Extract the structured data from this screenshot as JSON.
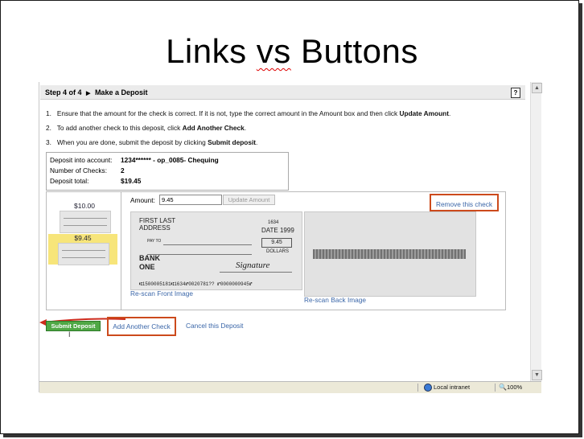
{
  "slide": {
    "title_part1": "Links ",
    "title_part2": "vs",
    "title_part3": " Buttons"
  },
  "header": {
    "step": "Step 4 of 4",
    "title": "Make a Deposit",
    "help": "?"
  },
  "instructions": [
    {
      "num": "1.",
      "text_before": "Ensure that the amount for the check is correct. If it is not, type the correct amount in the Amount box and then click ",
      "bold": "Update Amount",
      "text_after": "."
    },
    {
      "num": "2.",
      "text_before": "To add another check to this deposit, click ",
      "bold": "Add Another Check",
      "text_after": "."
    },
    {
      "num": "3.",
      "text_before": "When you are done, submit the deposit by clicking ",
      "bold": "Submit deposit",
      "text_after": "."
    }
  ],
  "summary": {
    "account_label": "Deposit into account:",
    "account_value": "1234****** - op_0085- Chequing",
    "checks_label": "Number of Checks:",
    "checks_value": "2",
    "total_label": "Deposit total:",
    "total_value": "$19.45"
  },
  "thumbnails": [
    {
      "amount": "$10.00",
      "selected": false
    },
    {
      "amount": "$9.45",
      "selected": true
    }
  ],
  "editor": {
    "amount_label": "Amount:",
    "amount_value": "9.45",
    "update_button": "Update Amount",
    "remove_link": "Remove this check"
  },
  "check_front": {
    "payer_line1": "FIRST LAST",
    "payer_line2": "ADDRESS",
    "check_no": "1634",
    "date": "DATE 1999",
    "pay_to": "PAY TO",
    "amount_box": "9.45",
    "dollars": "DOLLARS",
    "bank_line1": "BANK",
    "bank_line2": "ONE",
    "signature": "Signature",
    "micr": "⑆1500005181⑆1634⑈0020781??  ⑈0000000945⑈"
  },
  "images": {
    "rescan_front": "Re-scan Front Image",
    "rescan_back": "Re-scan Back Image"
  },
  "actions": {
    "submit": "Submit Deposit",
    "add_check": "Add Another Check",
    "cancel": "Cancel this Deposit"
  },
  "statusbar": {
    "zone": "Local intranet",
    "zoom": "100%"
  },
  "colors": {
    "highlight_box": "#cc4a1c",
    "link": "#3a66a8",
    "submit_green": "#4fa845",
    "selected_thumb": "#f7e57a"
  }
}
